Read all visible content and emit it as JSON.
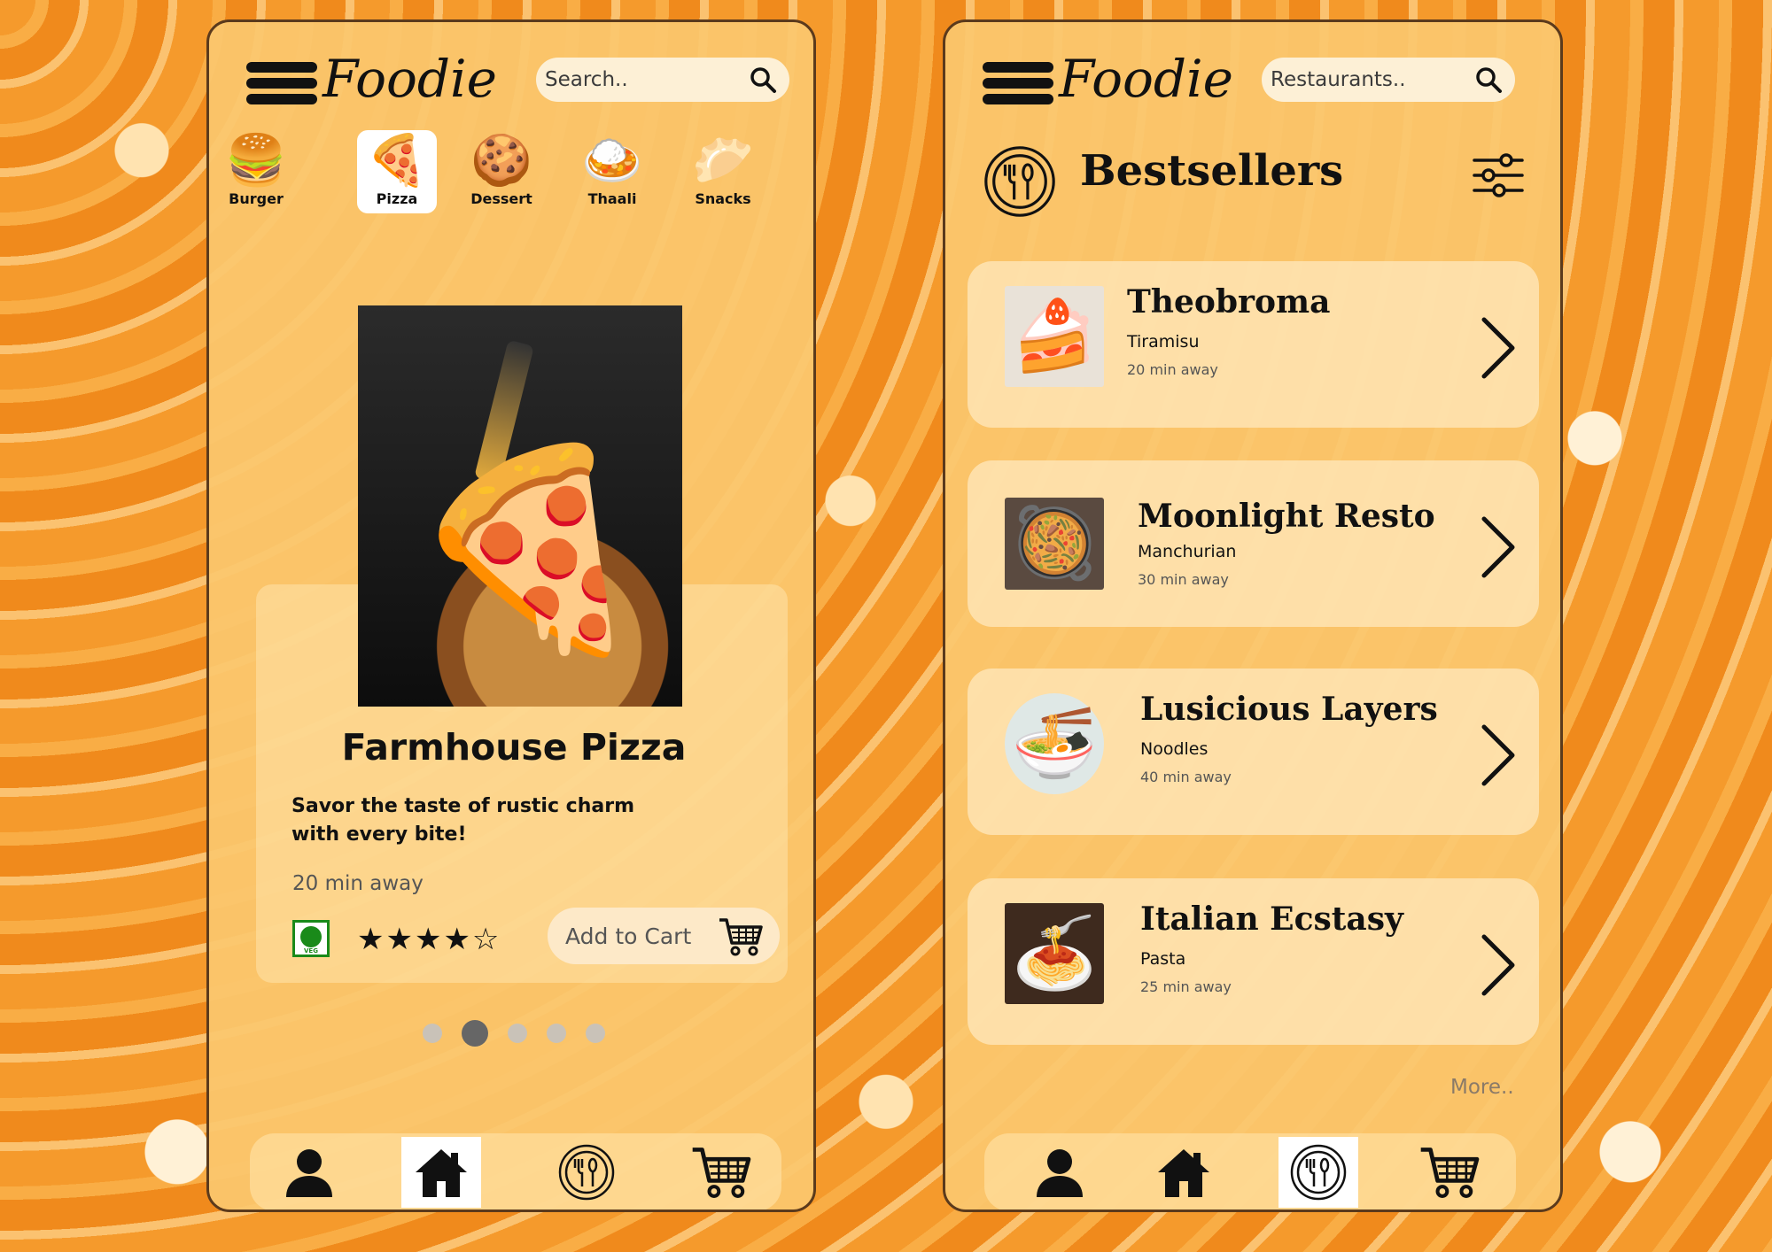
{
  "left_screen": {
    "app_name": "Foodie",
    "search_placeholder": "Search..",
    "categories": [
      {
        "label": "Burger",
        "icon": "burger-icon",
        "glyph": "🍔",
        "active": false
      },
      {
        "label": "Pizza",
        "icon": "pizza-icon",
        "glyph": "🍕",
        "active": true
      },
      {
        "label": "Dessert",
        "icon": "cookie-icon",
        "glyph": "🍪",
        "active": false
      },
      {
        "label": "Thaali",
        "icon": "thali-icon",
        "glyph": "🍛",
        "active": false
      },
      {
        "label": "Snacks",
        "icon": "samosa-icon",
        "glyph": "🥟",
        "active": false
      }
    ],
    "product": {
      "title": "Farmhouse Pizza",
      "tagline": "Savor the taste of rustic charm with every bite!",
      "distance": "20 min away",
      "veg_label": "VEG",
      "rating_stars": "★★★★☆",
      "rating": 4,
      "rating_max": 5,
      "add_to_cart_label": "Add to Cart"
    },
    "carousel": {
      "count": 5,
      "active_index": 1
    },
    "bottom_nav_active": "home"
  },
  "right_screen": {
    "app_name": "Foodie",
    "search_placeholder": "Restaurants..",
    "section_title": "Bestsellers",
    "restaurants": [
      {
        "name": "Theobroma",
        "dish": "Tiramisu",
        "time": "20 min away",
        "glyph": "🍰"
      },
      {
        "name": "Moonlight Resto",
        "dish": "Manchurian",
        "time": "30 min away",
        "glyph": "🥘"
      },
      {
        "name": "Lusicious Layers",
        "dish": "Noodles",
        "time": "40 min away",
        "glyph": "🍜"
      },
      {
        "name": "Italian Ecstasy",
        "dish": "Pasta",
        "time": "25 min away",
        "glyph": "🍝"
      }
    ],
    "more_label": "More..",
    "bottom_nav_active": "restaurants"
  },
  "colors": {
    "phone_bg": "#fbc76e",
    "accent_dark": "#111111",
    "veg_green": "#1a8a1a",
    "frame_border": "#5b3a1c"
  }
}
